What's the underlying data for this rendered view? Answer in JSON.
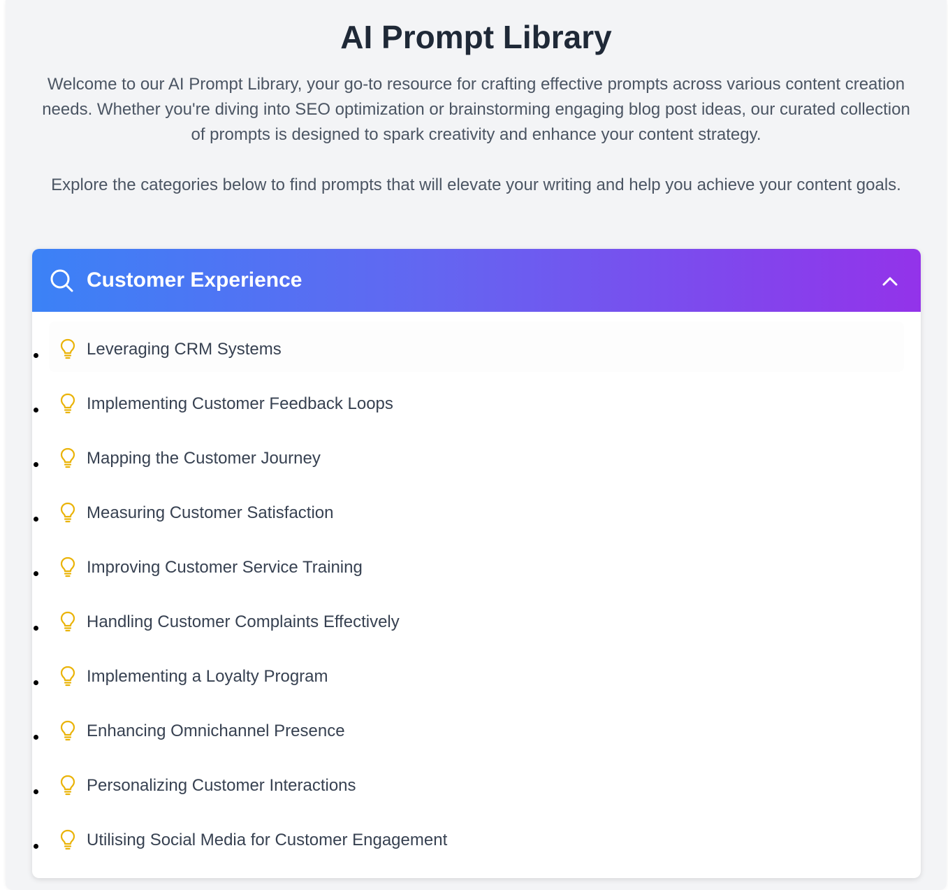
{
  "page": {
    "title": "AI Prompt Library",
    "intro": "Welcome to our AI Prompt Library, your go-to resource for crafting effective prompts across various content creation needs. Whether you're diving into SEO optimization or brainstorming engaging blog post ideas, our curated collection of prompts is designed to spark creativity and enhance your content strategy.",
    "explore": "Explore the categories below to find prompts that will elevate your writing and help you achieve your content goals."
  },
  "category": {
    "title": "Customer Experience",
    "expanded": true,
    "icon": "search-icon",
    "toggle_icon": "chevron-up-icon",
    "item_icon": "lightbulb-icon",
    "colors": {
      "gradient_start": "#3b82f6",
      "gradient_mid": "#6366f1",
      "gradient_end": "#9333ea",
      "bulb": "#eab308"
    },
    "items": [
      {
        "label": "Leveraging CRM Systems"
      },
      {
        "label": "Implementing Customer Feedback Loops"
      },
      {
        "label": "Mapping the Customer Journey"
      },
      {
        "label": "Measuring Customer Satisfaction"
      },
      {
        "label": "Improving Customer Service Training"
      },
      {
        "label": "Handling Customer Complaints Effectively"
      },
      {
        "label": "Implementing a Loyalty Program"
      },
      {
        "label": "Enhancing Omnichannel Presence"
      },
      {
        "label": "Personalizing Customer Interactions"
      },
      {
        "label": "Utilising Social Media for Customer Engagement"
      }
    ]
  }
}
